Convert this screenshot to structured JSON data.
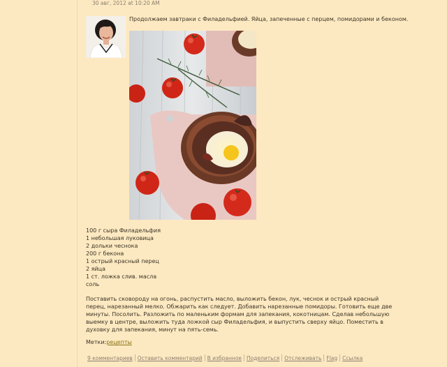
{
  "post": {
    "date": "30 авг, 2012 at 10:20 AM",
    "intro": "Продолжаем завтраки с Филадельфией. Яйца, запеченные с перцем, помидорами и беконом.",
    "ingredients": [
      "100 г сыра Филадельфия",
      "1 небольшая луковица",
      "2 дольки чеснока",
      "200 г бекона",
      "1 острый красный перец",
      "2 яйца",
      "1 ст. ложка слив. масла",
      "соль"
    ],
    "instructions": "Поставить сковороду на огонь, распустить масло, выложить бекон, лук, чеснок и острый красный перец, нарезанный мелко. Обжарить как следует. Добавить нарезанные помидоры. Готовить еще две минуты. Посолить. Разложить по маленьким формам для запекания, кокотницам. Сделав небольшую выемку в центре, выложить туда ложкой сыр Филадельфия, и выпустить сверху яйцо. Поместить в духовку для запекания, минут на пять-семь.",
    "tags_label": "Метки:",
    "tag": "рецепты"
  },
  "footer": {
    "links": [
      "9 комментариев",
      "Оставить комментарий",
      "В избранное",
      "Поделиться",
      "Отслеживать",
      "Flag",
      "Ссылка"
    ]
  },
  "colors": {
    "background": "#fde9c1",
    "tag_link": "#8a7316",
    "muted_text": "#8a7f6f"
  }
}
